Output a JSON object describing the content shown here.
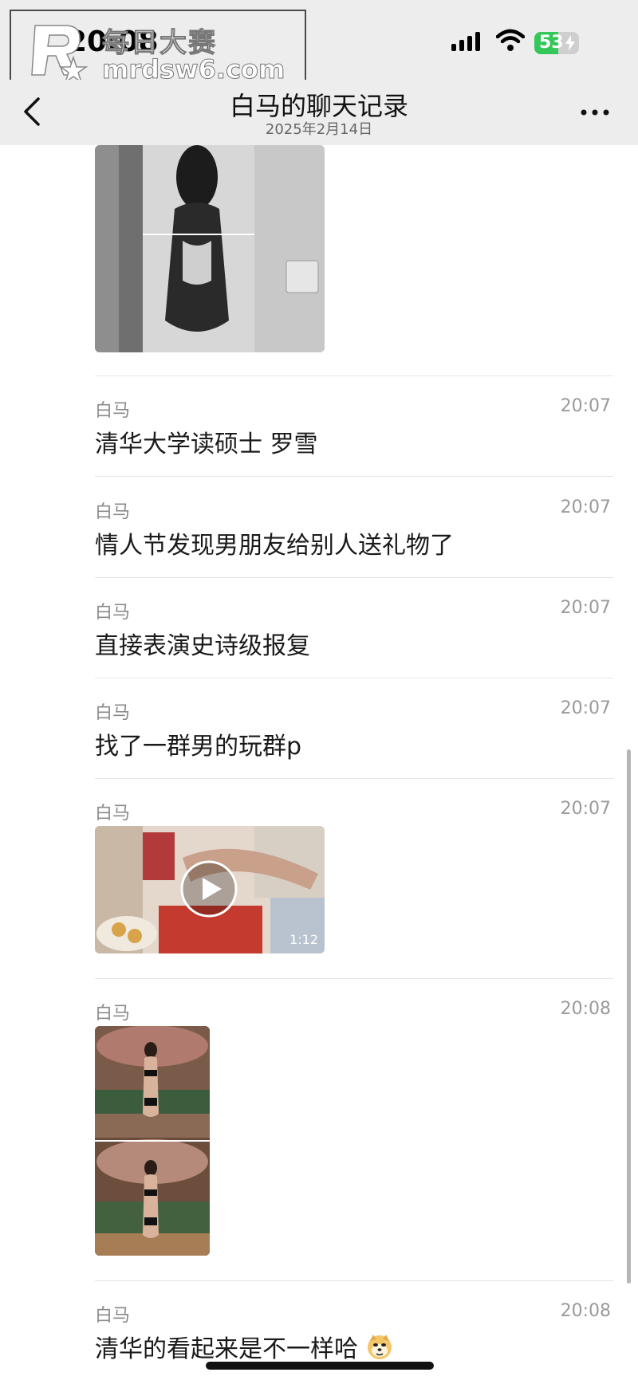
{
  "status_bar": {
    "time": "20:08",
    "battery_level": "53",
    "watermark_title": "每日大赛",
    "watermark_url": "mrdsw6.com"
  },
  "header": {
    "title": "白马的聊天记录",
    "subtitle": "2025年2月14日"
  },
  "messages": [
    {
      "sender": "白马",
      "time": "20:07",
      "text": "清华大学读硕士  罗雪"
    },
    {
      "sender": "白马",
      "time": "20:07",
      "text": "情人节发现男朋友给别人送礼物了"
    },
    {
      "sender": "白马",
      "time": "20:07",
      "text": "直接表演史诗级报复"
    },
    {
      "sender": "白马",
      "time": "20:07",
      "text": "找了一群男的玩群p"
    },
    {
      "sender": "白马",
      "time": "20:07",
      "video_duration": "1:12"
    },
    {
      "sender": "白马",
      "time": "20:08"
    },
    {
      "sender": "白马",
      "time": "20:08",
      "text": "清华的看起来是不一样哈"
    }
  ],
  "colors": {
    "header_bg": "#ededed",
    "battery_green": "#34c759",
    "divider": "#e5e5e5"
  }
}
